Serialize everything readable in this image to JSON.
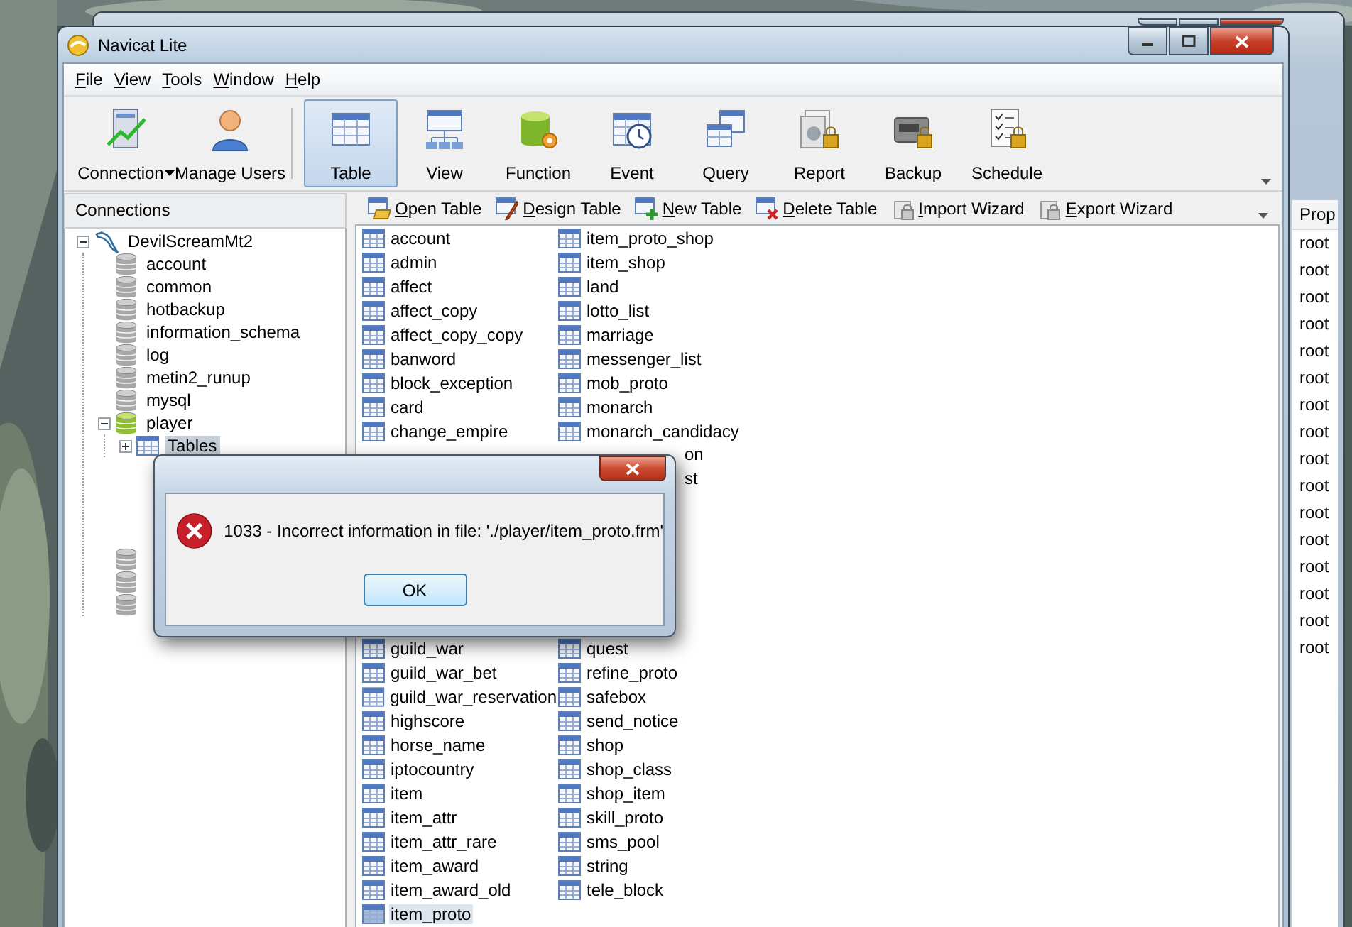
{
  "background_window": {
    "column_header": "Prop",
    "cells": [
      "root",
      "root",
      "root",
      "root",
      "root",
      "root",
      "root",
      "root",
      "root",
      "root",
      "root",
      "root",
      "root",
      "root",
      "root",
      "root"
    ]
  },
  "window": {
    "title": "Navicat Lite"
  },
  "menu": [
    "File",
    "View",
    "Tools",
    "Window",
    "Help"
  ],
  "toolbar": {
    "left": [
      {
        "label": "Connection",
        "dropdown": true
      },
      {
        "label": "Manage Users",
        "dropdown": false
      }
    ],
    "objects": [
      {
        "label": "Table",
        "selected": true
      },
      {
        "label": "View",
        "selected": false
      },
      {
        "label": "Function",
        "selected": false
      },
      {
        "label": "Event",
        "selected": false
      },
      {
        "label": "Query",
        "selected": false
      },
      {
        "label": "Report",
        "selected": false
      },
      {
        "label": "Backup",
        "selected": false
      },
      {
        "label": "Schedule",
        "selected": false
      }
    ]
  },
  "connections": {
    "title": "Connections",
    "tree": [
      {
        "name": "DevilScreamMt2",
        "kind": "connection",
        "expanded": true,
        "selected": false,
        "children": [
          {
            "name": "account",
            "kind": "database",
            "selected": false
          },
          {
            "name": "common",
            "kind": "database",
            "selected": false
          },
          {
            "name": "hotbackup",
            "kind": "database",
            "selected": false
          },
          {
            "name": "information_schema",
            "kind": "database",
            "selected": false
          },
          {
            "name": "log",
            "kind": "database",
            "selected": false
          },
          {
            "name": "metin2_runup",
            "kind": "database",
            "selected": false
          },
          {
            "name": "mysql",
            "kind": "database",
            "selected": false
          },
          {
            "name": "player",
            "kind": "database_open",
            "expanded": true,
            "selected": false,
            "children": [
              {
                "name": "Tables",
                "kind": "tables",
                "expanded": false,
                "selected": true
              }
            ]
          },
          {
            "kind": "database"
          },
          {
            "kind": "database"
          },
          {
            "kind": "database"
          }
        ]
      }
    ]
  },
  "object_toolbar": [
    "Open Table",
    "Design Table",
    "New Table",
    "Delete Table",
    "Import Wizard",
    "Export Wizard"
  ],
  "tables": {
    "column_1_top": [
      {
        "name": "account",
        "selected": false
      },
      {
        "name": "admin",
        "selected": false
      },
      {
        "name": "affect",
        "selected": false
      },
      {
        "name": "affect_copy",
        "selected": false
      },
      {
        "name": "affect_copy_copy",
        "selected": false
      },
      {
        "name": "banword",
        "selected": false
      },
      {
        "name": "block_exception",
        "selected": false
      },
      {
        "name": "card",
        "selected": false
      },
      {
        "name": "change_empire",
        "selected": false
      }
    ],
    "column_1_bottom": [
      {
        "name": "guild_war",
        "selected": false
      },
      {
        "name": "guild_war_bet",
        "selected": false
      },
      {
        "name": "guild_war_reservation",
        "selected": false
      },
      {
        "name": "highscore",
        "selected": false
      },
      {
        "name": "horse_name",
        "selected": false
      },
      {
        "name": "iptocountry",
        "selected": false
      },
      {
        "name": "item",
        "selected": false
      },
      {
        "name": "item_attr",
        "selected": false
      },
      {
        "name": "item_attr_rare",
        "selected": false
      },
      {
        "name": "item_award",
        "selected": false
      },
      {
        "name": "item_award_old",
        "selected": false
      },
      {
        "name": "item_proto",
        "selected": true
      }
    ],
    "column_2_top": [
      {
        "name": "item_proto_shop",
        "selected": false
      },
      {
        "name": "item_shop",
        "selected": false
      },
      {
        "name": "land",
        "selected": false
      },
      {
        "name": "lotto_list",
        "selected": false
      },
      {
        "name": "marriage",
        "selected": false
      },
      {
        "name": "messenger_list",
        "selected": false
      },
      {
        "name": "mob_proto",
        "selected": false
      },
      {
        "name": "monarch",
        "selected": false
      },
      {
        "name": "monarch_candidacy",
        "selected": false
      }
    ],
    "column_2_tails": [
      "on",
      "st"
    ],
    "column_2_bottom": [
      {
        "name": "quest",
        "selected": false
      },
      {
        "name": "refine_proto",
        "selected": false
      },
      {
        "name": "safebox",
        "selected": false
      },
      {
        "name": "send_notice",
        "selected": false
      },
      {
        "name": "shop",
        "selected": false
      },
      {
        "name": "shop_class",
        "selected": false
      },
      {
        "name": "shop_item",
        "selected": false
      },
      {
        "name": "skill_proto",
        "selected": false
      },
      {
        "name": "sms_pool",
        "selected": false
      },
      {
        "name": "string",
        "selected": false
      },
      {
        "name": "tele_block",
        "selected": false
      }
    ]
  },
  "dialog": {
    "message": "1033 - Incorrect information in file: './player/item_proto.frm'",
    "button": "OK"
  }
}
